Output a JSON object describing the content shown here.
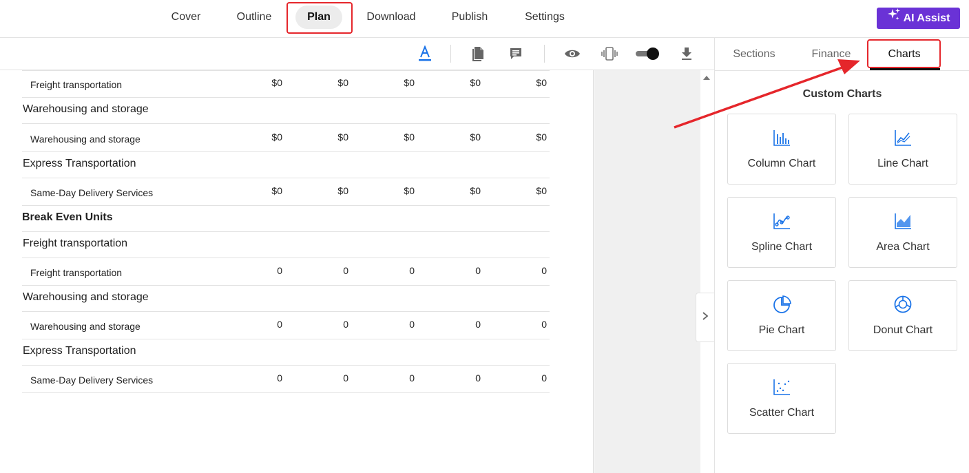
{
  "nav": {
    "items": [
      "Cover",
      "Outline",
      "Plan",
      "Download",
      "Publish",
      "Settings"
    ],
    "active": "Plan",
    "ai_assist_label": "AI Assist"
  },
  "toolbar": {
    "icons": [
      "text-format-icon",
      "document-icon",
      "comment-icon",
      "eye-icon",
      "device-preview-icon",
      "toggle-switch",
      "download-icon"
    ]
  },
  "table": {
    "rows": [
      {
        "label": "Freight transportation",
        "level": "sub",
        "values": [
          "$0",
          "$0",
          "$0",
          "$0",
          "$0"
        ]
      },
      {
        "label": "Warehousing and storage",
        "level": "head",
        "values": []
      },
      {
        "label": "Warehousing and storage",
        "level": "sub",
        "values": [
          "$0",
          "$0",
          "$0",
          "$0",
          "$0"
        ]
      },
      {
        "label": "Express Transportation",
        "level": "head",
        "values": []
      },
      {
        "label": "Same-Day Delivery Services",
        "level": "sub",
        "values": [
          "$0",
          "$0",
          "$0",
          "$0",
          "$0"
        ]
      },
      {
        "label": "Break Even Units",
        "level": "bold",
        "values": []
      },
      {
        "label": "Freight transportation",
        "level": "head",
        "values": []
      },
      {
        "label": "Freight transportation",
        "level": "sub",
        "values": [
          "0",
          "0",
          "0",
          "0",
          "0"
        ]
      },
      {
        "label": "Warehousing and storage",
        "level": "head",
        "values": []
      },
      {
        "label": "Warehousing and storage",
        "level": "sub",
        "values": [
          "0",
          "0",
          "0",
          "0",
          "0"
        ]
      },
      {
        "label": "Express Transportation",
        "level": "head",
        "values": []
      },
      {
        "label": "Same-Day Delivery Services",
        "level": "sub",
        "values": [
          "0",
          "0",
          "0",
          "0",
          "0"
        ]
      }
    ]
  },
  "right_panel": {
    "tabs": [
      "Sections",
      "Finance",
      "Charts"
    ],
    "active_tab": "Charts",
    "title": "Custom Charts",
    "charts": [
      {
        "label": "Column Chart",
        "icon": "column-chart-icon"
      },
      {
        "label": "Line Chart",
        "icon": "line-chart-icon"
      },
      {
        "label": "Spline Chart",
        "icon": "spline-chart-icon"
      },
      {
        "label": "Area Chart",
        "icon": "area-chart-icon"
      },
      {
        "label": "Pie Chart",
        "icon": "pie-chart-icon"
      },
      {
        "label": "Donut Chart",
        "icon": "donut-chart-icon"
      },
      {
        "label": "Scatter Chart",
        "icon": "scatter-chart-icon"
      }
    ]
  },
  "colors": {
    "accent": "#6a32d6",
    "highlight": "#e5262b",
    "icon_blue": "#1a73e8"
  }
}
